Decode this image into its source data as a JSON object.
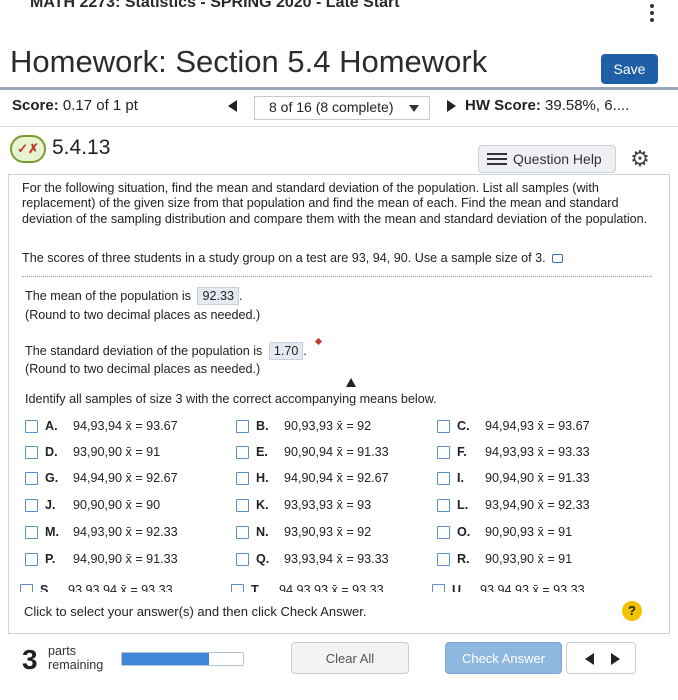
{
  "top": {
    "course_text": "MATH 2273: Statistics - SPRING 2020 - Late Start"
  },
  "header": {
    "title": "Homework: Section 5.4 Homework",
    "save_label": "Save"
  },
  "scorebar": {
    "score_label": "Score:",
    "score_value": "0.17 of 1 pt",
    "question_selector": "8 of 16 (8 complete)",
    "hw_label": "HW Score:",
    "hw_value": "39.58%, 6...."
  },
  "question": {
    "number": "5.4.13",
    "status_icon": "partial-credit-icon",
    "help_label": "Question Help"
  },
  "prompt": {
    "paragraph": "For the following situation, find the mean and standard deviation of the population. List all samples (with replacement) of the given size from that population and find the mean of each. Find the mean and standard deviation of the sampling distribution and compare them with the mean and standard deviation of the population.",
    "scores_line": "The scores of three students in a study group on a test are 93, 94, 90. Use a sample size of 3."
  },
  "answers": {
    "mean_prefix": "The mean of the population is",
    "mean_value": "92.33",
    "mean_suffix": ".",
    "mean_note": "(Round to two decimal places as needed.)",
    "sd_prefix": "The standard deviation of the population is",
    "sd_value": "1.70",
    "sd_suffix": ".",
    "sd_note": "(Round to two decimal places as needed.)"
  },
  "samples": {
    "instruction": "Identify all samples of size 3 with the correct accompanying means below.",
    "options": [
      {
        "letter": "A.",
        "text": "94,93,94 x̄ = 93.67"
      },
      {
        "letter": "B.",
        "text": "90,93,93 x̄ = 92"
      },
      {
        "letter": "C.",
        "text": "94,94,93 x̄ = 93.67"
      },
      {
        "letter": "D.",
        "text": "93,90,90 x̄ = 91"
      },
      {
        "letter": "E.",
        "text": "90,90,94 x̄ = 91.33"
      },
      {
        "letter": "F.",
        "text": "94,93,93 x̄ = 93.33"
      },
      {
        "letter": "G.",
        "text": "94,94,90 x̄ = 92.67"
      },
      {
        "letter": "H.",
        "text": "94,90,94 x̄ = 92.67"
      },
      {
        "letter": "I.",
        "text": "90,94,90 x̄ = 91.33"
      },
      {
        "letter": "J.",
        "text": "90,90,90 x̄ = 90"
      },
      {
        "letter": "K.",
        "text": "93,93,93 x̄ = 93"
      },
      {
        "letter": "L.",
        "text": "93,94,90 x̄ = 92.33"
      },
      {
        "letter": "M.",
        "text": "94,93,90 x̄ = 92.33"
      },
      {
        "letter": "N.",
        "text": "93,90,93 x̄ = 92"
      },
      {
        "letter": "O.",
        "text": "90,90,93 x̄ = 91"
      },
      {
        "letter": "P.",
        "text": "94,90,90 x̄ = 91.33"
      },
      {
        "letter": "Q.",
        "text": "93,93,94 x̄ = 93.33"
      },
      {
        "letter": "R.",
        "text": "90,93,90 x̄ = 91"
      },
      {
        "letter": "S.",
        "text": "93,93,94 x̄ = 93.33"
      },
      {
        "letter": "T.",
        "text": "94,93,93 x̄ = 93.33"
      },
      {
        "letter": "U.",
        "text": "93,94,93 x̄ = 93.33"
      }
    ]
  },
  "footer": {
    "click_instruction": "Click to select your answer(s) and then click Check Answer.",
    "help_glyph": "?",
    "parts_count": "3",
    "parts_label": "parts remaining",
    "progress_fraction": 0.72,
    "clear_label": "Clear All",
    "check_label": "Check Answer"
  },
  "colors": {
    "save_button": "#1f5fa8",
    "check_button": "#8fb8e0",
    "progress_fill": "#3d86d8",
    "checkbox_border": "#5d8fc9",
    "help_circle": "#f2c200"
  }
}
